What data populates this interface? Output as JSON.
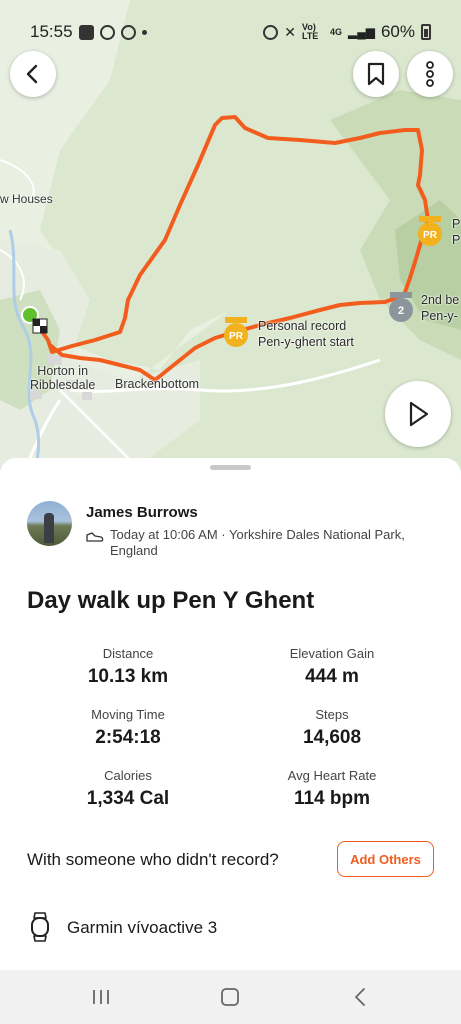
{
  "status_bar": {
    "time": "15:55",
    "network": "Vo) LTE",
    "signal_label": "4G",
    "battery": "60%"
  },
  "map": {
    "labels": {
      "houses": "w Houses",
      "horton": "Horton in\nRibblesdale",
      "brackenbottom": "Brackenbottom",
      "pr_start": "Personal record\nPen-y-ghent start",
      "second_best": "2nd be\nPen-y-",
      "pr_right": "P\nP"
    },
    "badges": {
      "pr": "PR",
      "second": "2"
    },
    "route_color": "#f25d1e"
  },
  "activity": {
    "athlete": "James Burrows",
    "meta": "Today at 10:06 AM · Yorkshire Dales National Park, England",
    "title": "Day walk up Pen Y Ghent",
    "stats": [
      {
        "label": "Distance",
        "value": "10.13 km"
      },
      {
        "label": "Elevation Gain",
        "value": "444 m"
      },
      {
        "label": "Moving Time",
        "value": "2:54:18"
      },
      {
        "label": "Steps",
        "value": "14,608"
      },
      {
        "label": "Calories",
        "value": "1,334 Cal"
      },
      {
        "label": "Avg Heart Rate",
        "value": "114 bpm"
      }
    ],
    "with_someone": "With someone who didn't record?",
    "add_others": "Add Others",
    "device": "Garmin vívoactive 3"
  },
  "colors": {
    "accent": "#f25d1e",
    "pr_gold": "#f2b21e",
    "second_silver": "#8d959c"
  }
}
